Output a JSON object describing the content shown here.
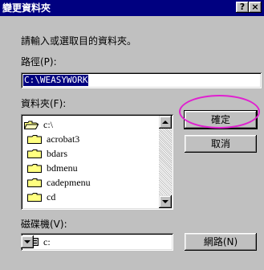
{
  "window": {
    "title": "變更資料夾",
    "help_label": "?",
    "close_label": "×"
  },
  "dialog": {
    "instruction": "請輸入或選取目的資料夾。",
    "path_label": "路徑(P):",
    "path_value": "C:\\WEASYWORK",
    "folders_label": "資料夾(F):",
    "drives_label": "磁碟機(V):"
  },
  "folders": [
    {
      "name": "c:\\",
      "icon": "open-folder-icon",
      "level": 0
    },
    {
      "name": "acrobat3",
      "icon": "folder-icon",
      "level": 1
    },
    {
      "name": "bdars",
      "icon": "folder-icon",
      "level": 1
    },
    {
      "name": "bdmenu",
      "icon": "folder-icon",
      "level": 1
    },
    {
      "name": "cadepmenu",
      "icon": "folder-icon",
      "level": 1
    },
    {
      "name": "cd",
      "icon": "folder-icon",
      "level": 1
    }
  ],
  "drive": {
    "value": "c:",
    "icon": "hard-drive-icon"
  },
  "buttons": {
    "ok": "確定",
    "cancel": "取消",
    "network": "網路(N)"
  },
  "colors": {
    "titlebar": "#000080",
    "dialog_bg": "#c0c0c0",
    "selection": "#000080",
    "annotation": "#e020d0"
  }
}
